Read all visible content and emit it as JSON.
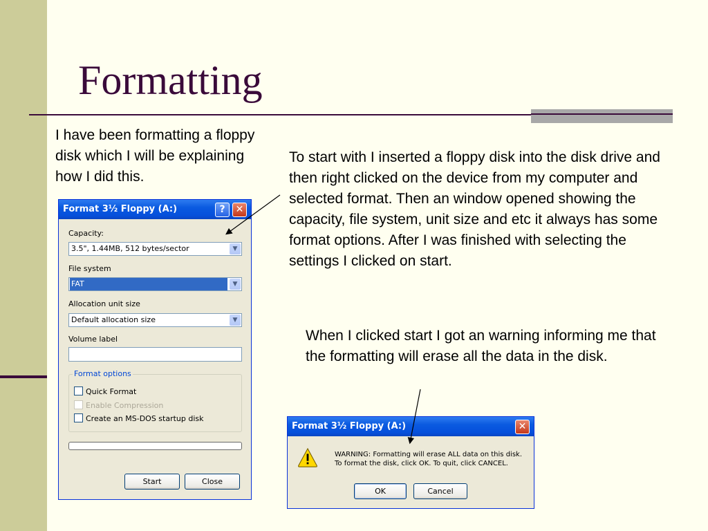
{
  "slide": {
    "title": "Formatting",
    "paragraph1": "I have been formatting a floppy disk which I will be explaining how I did this.",
    "paragraph2": "To start with I inserted a floppy disk into the disk drive and then right clicked on the device from my computer and selected format. Then an window opened showing the capacity, file system, unit size and etc it always has some format options. After I was finished with selecting the settings I clicked on start.",
    "paragraph3": "When I clicked start I got an warning informing me that the formatting will erase all the data in the disk."
  },
  "format_dialog": {
    "title": "Format 3½ Floppy (A:)",
    "help_glyph": "?",
    "close_glyph": "✕",
    "capacity_label": "Capacity:",
    "capacity_value": "3.5\",  1.44MB, 512 bytes/sector",
    "filesystem_label": "File system",
    "filesystem_value": "FAT",
    "allocation_label": "Allocation unit size",
    "allocation_value": "Default allocation size",
    "volume_label": "Volume label",
    "volume_value": "",
    "options_label": "Format options",
    "quick_format": "Quick Format",
    "enable_compression": "Enable Compression",
    "msdos_startup": "Create an MS-DOS startup disk",
    "progress": 0,
    "start_label": "Start",
    "close_label": "Close"
  },
  "warning_dialog": {
    "title": "Format 3½ Floppy (A:)",
    "close_glyph": "✕",
    "message_line1": "WARNING: Formatting will erase ALL data on this disk.",
    "message_line2": "To format the disk, click OK. To quit, click CANCEL.",
    "ok_label": "OK",
    "cancel_label": "Cancel",
    "icon": "warning-icon"
  },
  "colors": {
    "background": "#FFFFF0",
    "sidebar": "#CCCC99",
    "title": "#3A0A3A",
    "xp_titlebar": "#0A5AE0",
    "dialog_face": "#ECE9D8"
  }
}
